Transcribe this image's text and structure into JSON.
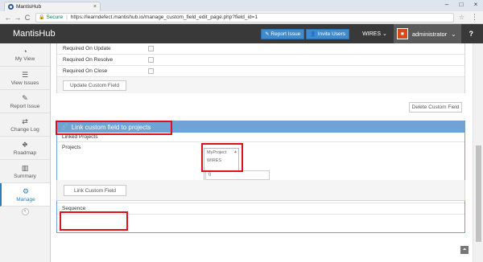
{
  "browser": {
    "tab_title": "MantisHub",
    "tab_close": "×",
    "window_controls": [
      "–",
      "□",
      "×"
    ],
    "nav": {
      "back": "←",
      "forward": "→",
      "reload": "C"
    },
    "secure_label": "Secure",
    "url": "https://learndefect.mantishub.io/manage_custom_field_edit_page.php?field_id=1"
  },
  "navbar": {
    "brand": "MantisHub",
    "report_issue": "Report Issue",
    "invite_users": "Invite Users",
    "project": "WIRES",
    "username": "administrator",
    "help": "?"
  },
  "sidebar": {
    "items": [
      {
        "label": "My View",
        "icon": "dashboard-icon"
      },
      {
        "label": "View Issues",
        "icon": "list-icon"
      },
      {
        "label": "Report Issue",
        "icon": "pencil-icon"
      },
      {
        "label": "Change Log",
        "icon": "retweet-icon"
      },
      {
        "label": "Roadmap",
        "icon": "road-icon"
      },
      {
        "label": "Summary",
        "icon": "bar-chart-icon"
      },
      {
        "label": "Manage",
        "icon": "gears-icon"
      }
    ]
  },
  "custom_field": {
    "rows": [
      "Required On Update",
      "Required On Resolve",
      "Required On Close"
    ],
    "update_button": "Update Custom Field",
    "delete_button": "Delete Custom Field"
  },
  "link_panel": {
    "title": "Link custom field to projects",
    "linked_projects_label": "Linked Projects",
    "projects_label": "Projects",
    "project_options": [
      "MyProject",
      "WIRES"
    ],
    "sequence_label": "Sequence",
    "sequence_value": "0",
    "link_button": "Link Custom Field"
  },
  "colors": {
    "navbar": "#393939",
    "primary": "#428bca",
    "panel_header": "#6fa3d5",
    "highlight": "#e0101c"
  }
}
